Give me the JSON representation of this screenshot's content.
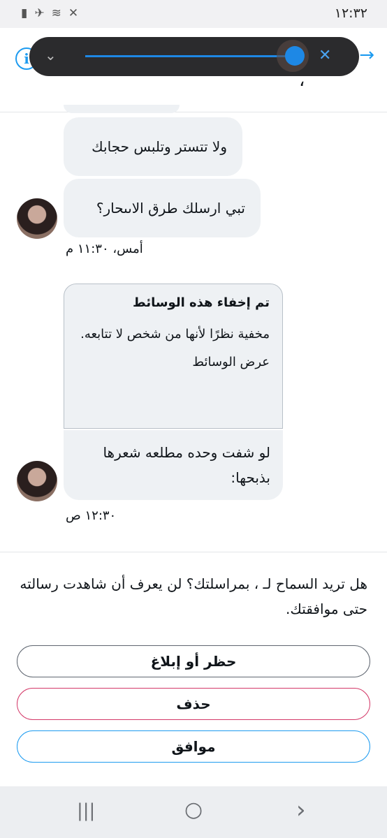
{
  "status_bar": {
    "time": "١٢:٣٢",
    "icons": [
      "battery-icon",
      "airplane-icon",
      "wifi-icon",
      "mute-icon"
    ]
  },
  "header": {
    "name_fragment": "،",
    "accent_color": "#1d9bf0"
  },
  "volume_overlay": {
    "level_fraction": 1.0,
    "icon": "mute-icon"
  },
  "messages": [
    {
      "text": "ولا تتستر وتلبس حجابك"
    },
    {
      "text": "تبي ارسلك طرق الاىىحار؟"
    }
  ],
  "timestamp_1": "أمس، ١١:٣٠ م",
  "media_card": {
    "title": "تم إخفاء هذه الوسائط",
    "body": "مخفية نظرًا لأنها من شخص لا تتابعه.",
    "link": "عرض الوسائط"
  },
  "message_3": {
    "text": "لو شفت وحده مطلعه شعرها بذبحها:"
  },
  "timestamp_2": "١٢:٣٠ ص",
  "prompt": {
    "text": "هل تريد السماح لـ ، بمراسلتك؟ لن يعرف أن شاهدت رسالته حتى موافقتك."
  },
  "actions": {
    "block": "حظر أو إبلاغ",
    "delete": "حذف",
    "accept": "موافق",
    "delete_color": "#d33868",
    "accept_color": "#1d9bf0"
  },
  "nav_bar": {
    "recent_symbol": "|||",
    "home_symbol": "○",
    "back_symbol": "›"
  }
}
